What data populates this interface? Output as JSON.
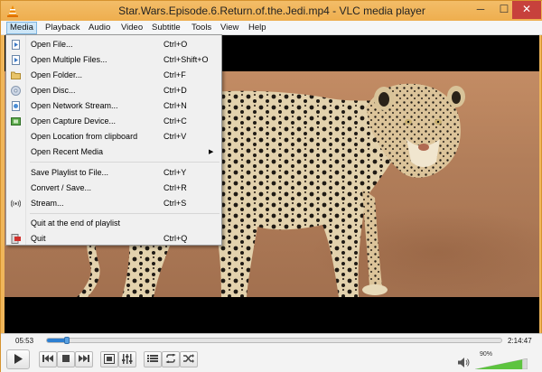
{
  "window": {
    "title": "Star.Wars.Episode.6.Return.of.the.Jedi.mp4 - VLC media player",
    "min": "─",
    "max": "☐",
    "close": "✕"
  },
  "menubar": [
    "Media",
    "Playback",
    "Audio",
    "Video",
    "Subtitle",
    "Tools",
    "View",
    "Help"
  ],
  "media_menu": {
    "items": [
      {
        "label": "Open File...",
        "shortcut": "Ctrl+O",
        "icon": "file-icon"
      },
      {
        "label": "Open Multiple Files...",
        "shortcut": "Ctrl+Shift+O",
        "icon": "files-icon"
      },
      {
        "label": "Open Folder...",
        "shortcut": "Ctrl+F",
        "icon": "folder-icon"
      },
      {
        "label": "Open Disc...",
        "shortcut": "Ctrl+D",
        "icon": "disc-icon"
      },
      {
        "label": "Open Network Stream...",
        "shortcut": "Ctrl+N",
        "icon": "network-icon"
      },
      {
        "label": "Open Capture Device...",
        "shortcut": "Ctrl+C",
        "icon": "capture-icon"
      },
      {
        "label": "Open Location from clipboard",
        "shortcut": "Ctrl+V",
        "icon": ""
      },
      {
        "label": "Open Recent Media",
        "shortcut": "",
        "icon": "",
        "submenu": "▶"
      },
      {
        "label": "Save Playlist to File...",
        "shortcut": "Ctrl+Y",
        "icon": ""
      },
      {
        "label": "Convert / Save...",
        "shortcut": "Ctrl+R",
        "icon": ""
      },
      {
        "label": "Stream...",
        "shortcut": "Ctrl+S",
        "icon": "stream-icon"
      },
      {
        "label": "Quit at the end of playlist",
        "shortcut": "",
        "icon": ""
      },
      {
        "label": "Quit",
        "shortcut": "Ctrl+Q",
        "icon": "quit-icon"
      }
    ]
  },
  "playback": {
    "current_time": "05:53",
    "total_time": "2:14:47",
    "progress_fraction": 0.044
  },
  "volume": {
    "percent_label": "90%",
    "level": 0.9
  },
  "colors": {
    "window_accent": "#f0b65a",
    "close_button": "#c7413c",
    "seek_fill": "#2d7fd1",
    "volume_fill": "#5dc43f"
  }
}
